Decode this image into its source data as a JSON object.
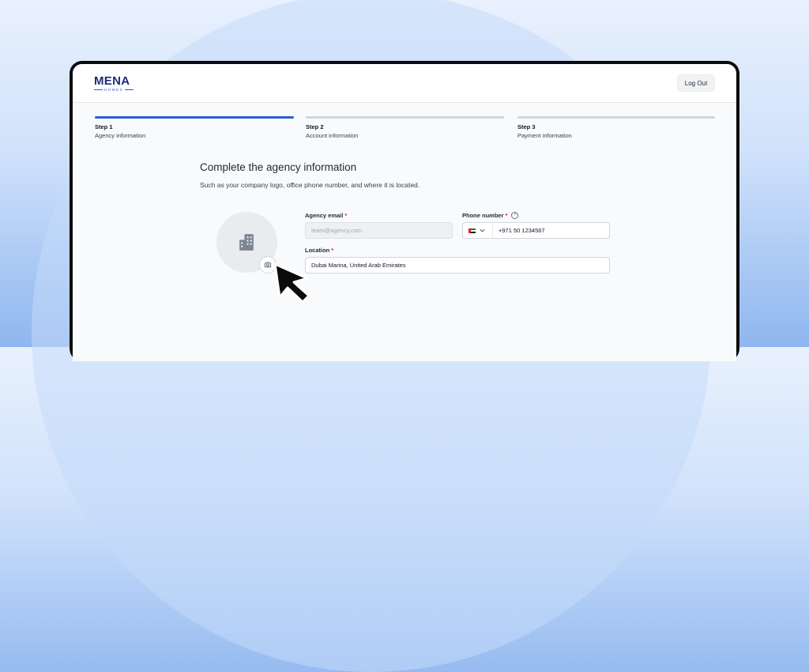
{
  "brand": {
    "name": "MENA",
    "tagline": "HOMES"
  },
  "header": {
    "logout_label": "Log Out"
  },
  "steps": [
    {
      "number": "Step 1",
      "label": "Agency information",
      "active": true
    },
    {
      "number": "Step 2",
      "label": "Account information",
      "active": false
    },
    {
      "number": "Step 3",
      "label": "Payment information",
      "active": false
    }
  ],
  "form": {
    "title": "Complete the agency information",
    "subtitle": "Such as your company logo, office phone number, and where it is located.",
    "email": {
      "label": "Agency email",
      "required_mark": "*",
      "placeholder": "team@agency.com"
    },
    "phone": {
      "label": "Phone number",
      "required_mark": "*",
      "help_glyph": "?",
      "country": "AE",
      "value": "+971 50 1234567"
    },
    "location": {
      "label": "Location",
      "required_mark": "*",
      "value": "Dubai Marina, United Arab Emirates"
    }
  },
  "icons": {
    "logo_placeholder": "building-icon",
    "upload": "camera-icon",
    "pointer": "cursor-arrow-icon",
    "dropdown": "chevron-down-icon"
  },
  "colors": {
    "accent": "#2f5fce",
    "brand": "#1e2a78",
    "required": "#e11d48"
  }
}
